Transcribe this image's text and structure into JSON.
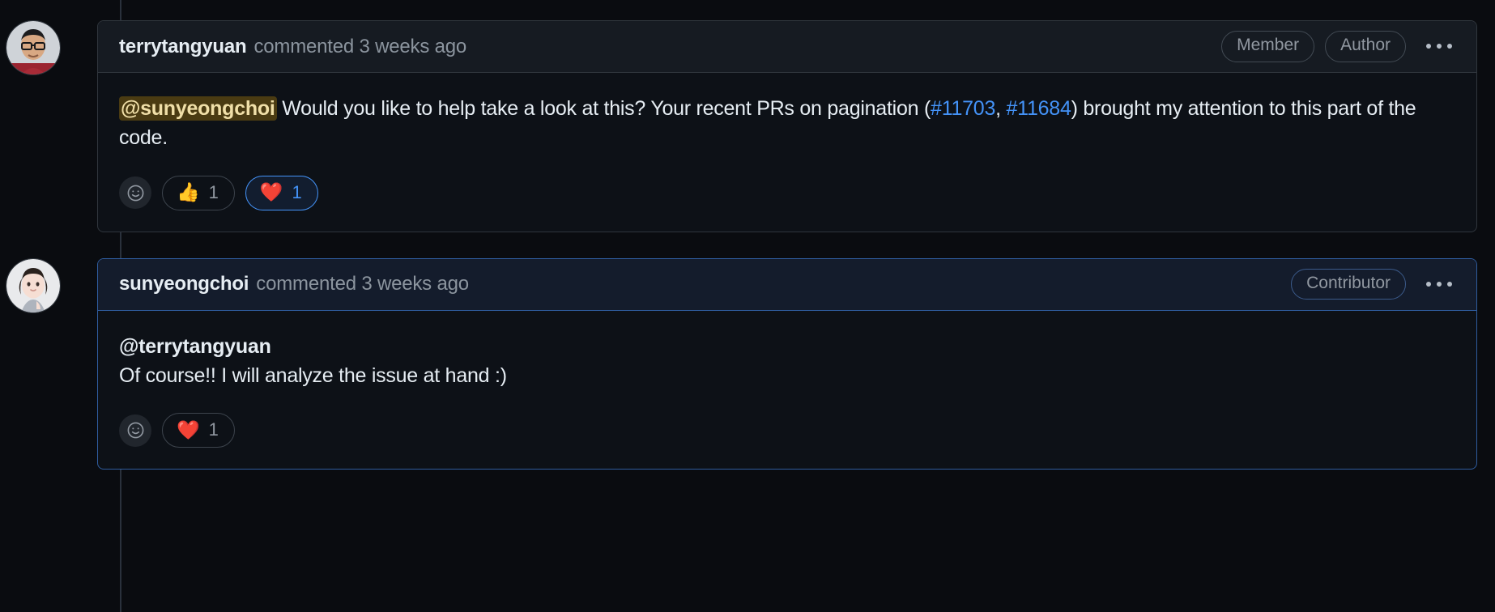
{
  "thread": {
    "comments": [
      {
        "author": "terrytangyuan",
        "meta": "commented 3 weeks ago",
        "avatar_name": "avatar-terrytangyuan",
        "badges": [
          "Member",
          "Author"
        ],
        "menu_label": "...",
        "highlighted": false,
        "body": {
          "mention": "@sunyeongchoi",
          "text_before_links": " Would you like to help take a look at this? Your recent PRs on pagination (",
          "link_1": "#11703",
          "separator": ", ",
          "link_2": "#11684",
          "text_after_links": ") brought my attention to this part of the code."
        },
        "reactions": {
          "add_label": "add-reaction",
          "items": [
            {
              "emoji": "👍",
              "name": "thumbs-up",
              "count": "1",
              "selected": false
            },
            {
              "emoji": "❤️",
              "name": "heart",
              "count": "1",
              "selected": true
            }
          ]
        }
      },
      {
        "author": "sunyeongchoi",
        "meta": "commented 3 weeks ago",
        "avatar_name": "avatar-sunyeongchoi",
        "badges": [
          "Contributor"
        ],
        "menu_label": "...",
        "highlighted": true,
        "body": {
          "mention": "@terrytangyuan",
          "line_2": "Of course!! I will analyze the issue at hand :)"
        },
        "reactions": {
          "add_label": "add-reaction",
          "items": [
            {
              "emoji": "❤️",
              "name": "heart",
              "count": "1",
              "selected": false
            }
          ]
        }
      }
    ]
  },
  "colors": {
    "page_background": "#0a0c10",
    "comment_background": "#0d1117",
    "header_background": "#161b22",
    "border": "#30363d",
    "highlight_border": "#2f5c9e",
    "highlight_header_background": "#141c2c",
    "link_blue": "#4493f8",
    "muted_text": "#8b949e",
    "mention_highlight_background": "#4a3b12",
    "mention_highlight_text": "#f0dfa8"
  }
}
